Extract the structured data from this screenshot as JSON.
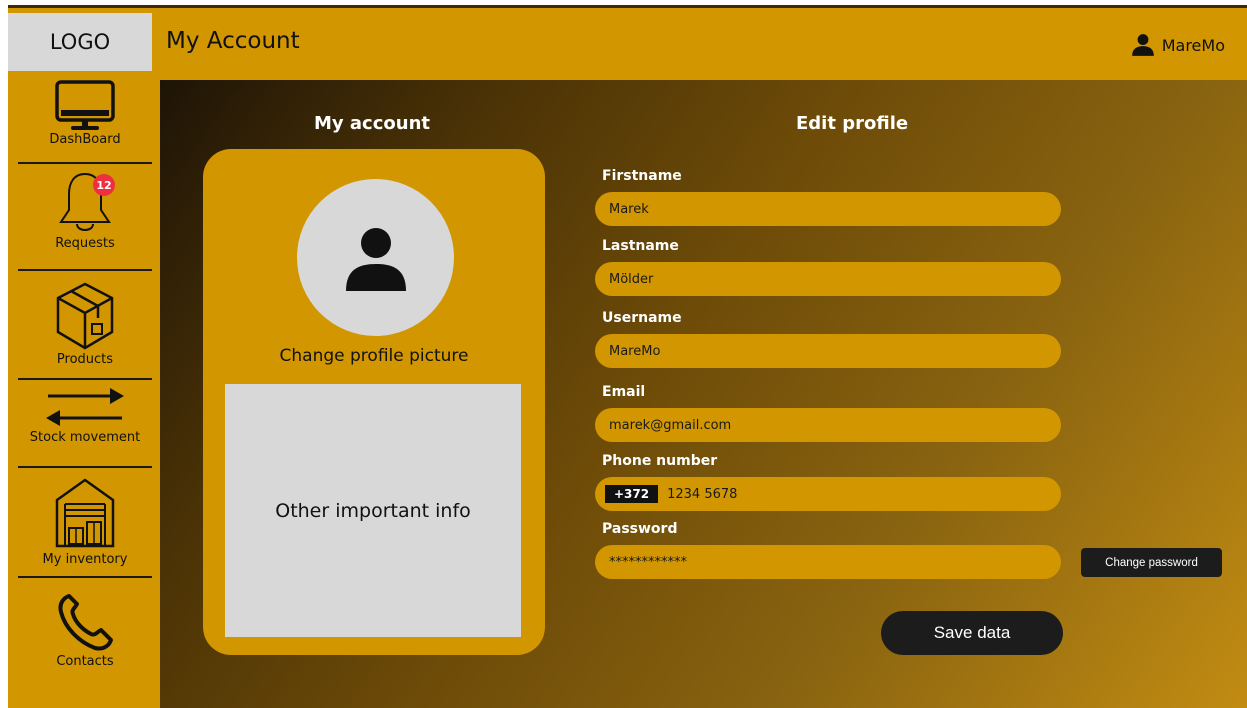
{
  "header": {
    "logo": "LOGO",
    "title": "My Account",
    "user_name": "MareMo",
    "user_icon": "user-icon"
  },
  "sidebar": {
    "items": [
      {
        "label": "DashBoard",
        "icon": "monitor-icon"
      },
      {
        "label": "Requests",
        "icon": "bell-icon",
        "badge": "12"
      },
      {
        "label": "Products",
        "icon": "box-icon"
      },
      {
        "label": "Stock movement",
        "icon": "arrows-icon"
      },
      {
        "label": "My inventory",
        "icon": "warehouse-icon"
      },
      {
        "label": "Contacts",
        "icon": "phone-icon"
      }
    ]
  },
  "account": {
    "heading": "My account",
    "change_picture": "Change profile picture",
    "info_text": "Other important info"
  },
  "profile": {
    "heading": "Edit profile",
    "fields": {
      "firstname": {
        "label": "Firstname",
        "value": "Marek"
      },
      "lastname": {
        "label": "Lastname",
        "value": "Mölder"
      },
      "username": {
        "label": "Username",
        "value": "MareMo"
      },
      "email": {
        "label": "Email",
        "value": "marek@gmail.com"
      },
      "phone": {
        "label": "Phone number",
        "code": "+372",
        "value": "1234 5678"
      },
      "password": {
        "label": "Password",
        "value": "************"
      }
    },
    "change_password": "Change password",
    "save": "Save data"
  },
  "colors": {
    "accent": "#d29600",
    "dark": "#1c1c1c",
    "badge": "#ee2f40",
    "panel_grey": "#d8d8d8"
  }
}
